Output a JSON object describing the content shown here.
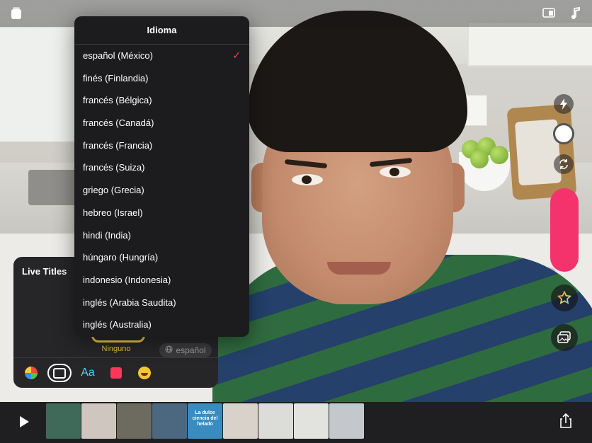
{
  "dropdown": {
    "title": "Idioma",
    "selected_index": 0,
    "items": [
      "español (México)",
      "finés (Finlandia)",
      "francés (Bélgica)",
      "francés (Canadá)",
      "francés (Francia)",
      "francés (Suiza)",
      "griego (Grecia)",
      "hebreo (Israel)",
      "hindi (India)",
      "húngaro (Hungría)",
      "indonesio (Indonesia)",
      "inglés (Arabia Saudita)",
      "inglés (Australia)"
    ],
    "check_color": "#ff375f"
  },
  "live_titles": {
    "title": "Live Titles",
    "style_label": "Ninguno",
    "language_label": "español",
    "tools": [
      {
        "name": "filters-icon"
      },
      {
        "name": "live-titles-icon",
        "selected": true
      },
      {
        "name": "text-icon",
        "label": "Aa"
      },
      {
        "name": "stickers-icon"
      },
      {
        "name": "emoji-icon"
      }
    ]
  },
  "camera_controls": {
    "record_color": "#f4336d",
    "icons": [
      "flash-icon",
      "shutter-icon",
      "flip-camera-icon",
      "effects-star-icon",
      "media-library-icon"
    ]
  },
  "topbar": {
    "icons": [
      "projects-icon",
      "layout-icon",
      "music-icon"
    ]
  },
  "timeline": {
    "thumbnails": [
      {
        "color": "#3f6a5a"
      },
      {
        "color": "#cfc7bf"
      },
      {
        "color": "#6d6a5f"
      },
      {
        "color": "#4b6880"
      },
      {
        "color": "#3a8bbf",
        "text": "La dulce ciencia del helado"
      },
      {
        "color": "#d8d2cb"
      },
      {
        "color": "#dcdcd8"
      },
      {
        "color": "#e2e2de"
      },
      {
        "color": "#c4c7cb"
      }
    ]
  }
}
